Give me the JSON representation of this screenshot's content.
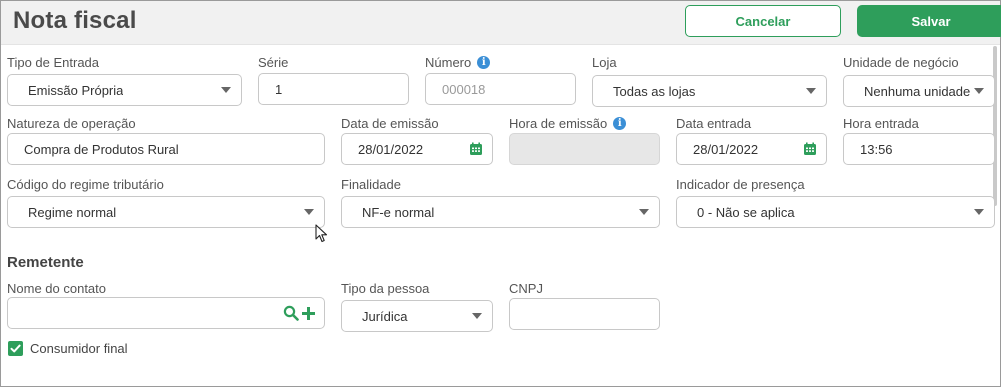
{
  "header": {
    "title": "Nota fiscal",
    "cancel_label": "Cancelar",
    "save_label": "Salvar"
  },
  "form": {
    "tipo_entrada": {
      "label": "Tipo de Entrada",
      "value": "Emissão Própria"
    },
    "serie": {
      "label": "Série",
      "value": "1"
    },
    "numero": {
      "label": "Número",
      "placeholder": "000018"
    },
    "loja": {
      "label": "Loja",
      "value": "Todas as lojas"
    },
    "unidade_negocio": {
      "label": "Unidade de negócio",
      "value": "Nenhuma unidade"
    },
    "natureza_operacao": {
      "label": "Natureza de operação",
      "value": "Compra de Produtos Rural"
    },
    "data_emissao": {
      "label": "Data de emissão",
      "value": "28/01/2022"
    },
    "hora_emissao": {
      "label": "Hora de emissão",
      "value": ""
    },
    "data_entrada": {
      "label": "Data entrada",
      "value": "28/01/2022"
    },
    "hora_entrada": {
      "label": "Hora entrada",
      "value": "13:56"
    },
    "codigo_regime": {
      "label": "Código do regime tributário",
      "value": "Regime normal"
    },
    "finalidade": {
      "label": "Finalidade",
      "value": "NF-e normal"
    },
    "indicador_presenca": {
      "label": "Indicador de presença",
      "value": "0 - Não se aplica"
    }
  },
  "remetente": {
    "title": "Remetente",
    "nome_contato": {
      "label": "Nome do contato",
      "value": ""
    },
    "tipo_pessoa": {
      "label": "Tipo da pessoa",
      "value": "Jurídica"
    },
    "cnpj": {
      "label": "CNPJ",
      "value": ""
    },
    "consumidor_final": {
      "label": "Consumidor final",
      "checked": true
    }
  },
  "colors": {
    "accent": "#2e9e5b",
    "info": "#3b8fd6",
    "disabled_bg": "#e7e7e7"
  },
  "icons": [
    "info-icon",
    "calendar-icon",
    "chevron-down-icon",
    "search-icon",
    "plus-icon",
    "check-icon",
    "mouse-cursor-icon"
  ]
}
